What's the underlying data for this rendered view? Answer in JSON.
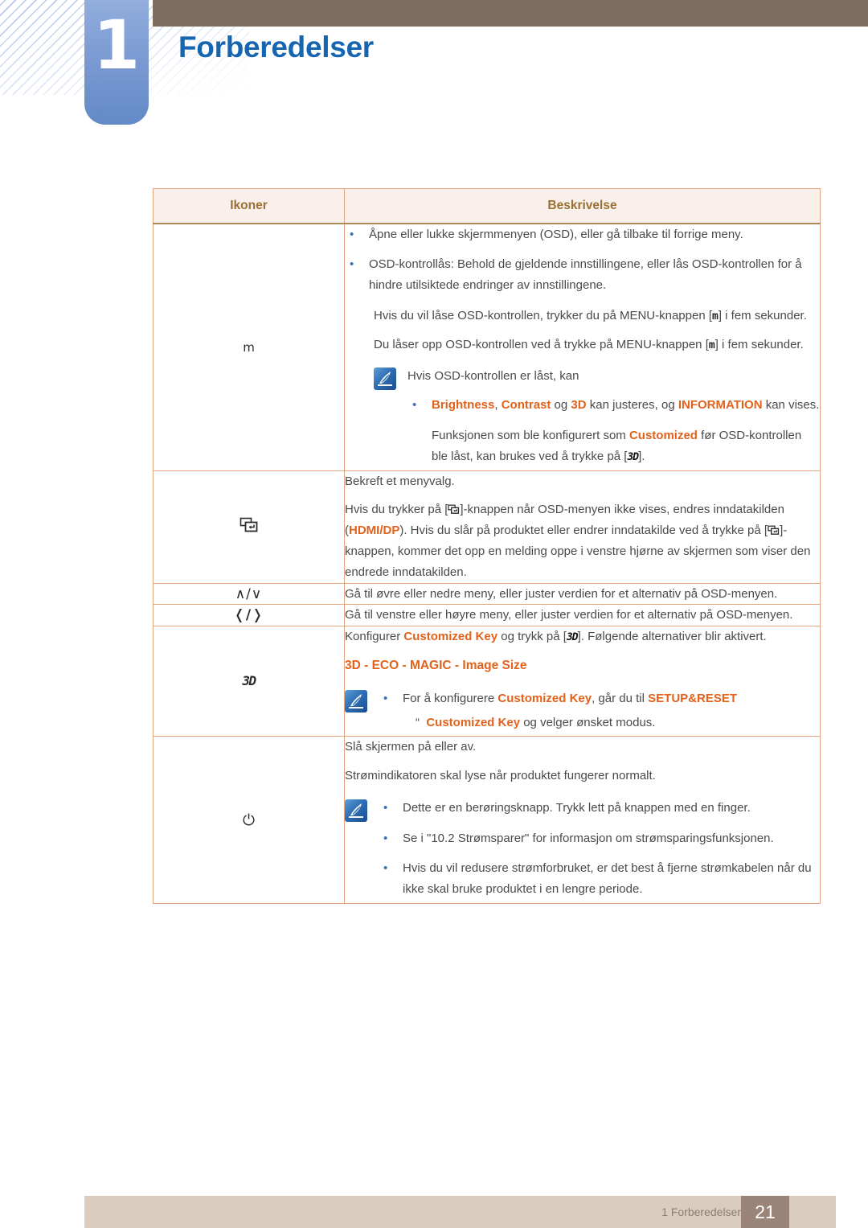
{
  "header": {
    "chapter_number": "1",
    "chapter_title": "Forberedelser"
  },
  "table": {
    "columns": [
      "Ikoner",
      "Beskrivelse"
    ],
    "rows": [
      {
        "icon_name": "menu-icon",
        "icon_glyph": "m",
        "blocks": {
          "b1": "Åpne eller lukke skjermmenyen (OSD), eller gå tilbake til forrige meny.",
          "b2": "OSD-kontrollås: Behold de gjeldende innstillingene, eller lås OSD-kontrollen for å hindre utilsiktede endringer av innstillingene.",
          "b3_pre": "Hvis du vil låse OSD-kontrollen, trykker du på MENU-knappen [",
          "b3_key": "m",
          "b3_post": "] i fem sekunder.",
          "b4_pre": "Du låser opp OSD-kontrollen ved å trykke på MENU-knappen [",
          "b4_key": "m",
          "b4_post": "] i fem sekunder.",
          "note_lead": "Hvis OSD-kontrollen er låst, kan",
          "note_b1_a": "Brightness",
          "note_b1_b": ", ",
          "note_b1_c": "Contrast",
          "note_b1_d": " og ",
          "note_b1_e": "3D",
          "note_b1_f": "  kan justeres, og ",
          "note_b1_g": "INFORMATION",
          "note_b1_h": " kan vises.",
          "note_b2_a": "Funksjonen som ble konfigurert som ",
          "note_b2_b": "Customized",
          "note_b2_c": " før OSD-kontrollen ble låst, kan brukes ved å trykke på [",
          "note_b2_key": "3D",
          "note_b2_d": "]."
        }
      },
      {
        "icon_name": "source-enter-icon",
        "icon_glyph": "",
        "blocks": {
          "p1": "Bekreft et menyvalg.",
          "p2_a": "Hvis du trykker på [",
          "p2_b": "]-knappen når OSD-menyen ikke vises, endres inndatakilden (",
          "p2_hdmi": "HDMI",
          "p2_slash": "/",
          "p2_dp": "DP",
          "p2_c": "). Hvis du slår på produktet eller endrer inndatakilde ved å trykke på [",
          "p2_d": "]-knappen, kommer det opp en melding oppe i venstre hjørne av skjermen som viser den endrede inndatakilden."
        }
      },
      {
        "icon_name": "up-down-icon",
        "icon_glyph": "∧/∨",
        "blocks": {
          "p1": "Gå til øvre eller nedre meny, eller juster verdien for et alternativ på OSD-menyen."
        }
      },
      {
        "icon_name": "left-right-icon",
        "icon_glyph": "❬/❭",
        "blocks": {
          "p1": "Gå til venstre eller høyre meny, eller juster verdien for et alternativ på OSD-menyen."
        }
      },
      {
        "icon_name": "3d-icon",
        "icon_glyph": "3D",
        "blocks": {
          "p1_a": "Konfigurer ",
          "p1_b": "Customized Key",
          "p1_c": " og trykk på [",
          "p1_key": "3D",
          "p1_d": "]. Følgende alternativer blir aktivert.",
          "p2": "3D - ECO - MAGIC - Image Size",
          "note_b1_a": "For å konfigurere ",
          "note_b1_b": "Customized Key",
          "note_b1_c": ", går du til ",
          "note_b1_d": "SETUP&RESET",
          "note_b2_quote": "“",
          "note_b2_a": "Customized Key",
          "note_b2_b": " og velger ønsket modus."
        }
      },
      {
        "icon_name": "power-icon",
        "icon_glyph": "⏻",
        "blocks": {
          "p1": "Slå skjermen på eller av.",
          "p2": "Strømindikatoren skal lyse når produktet fungerer normalt.",
          "note_b1": "Dette er en berøringsknapp. Trykk lett på knappen med en finger.",
          "note_b2": "Se i \"10.2 Strømsparer\" for informasjon om strømsparingsfunksjonen.",
          "note_b3": "Hvis du vil redusere strømforbruket, er det best å fjerne strømkabelen når du ikke skal bruke produktet i en lengre periode."
        }
      }
    ]
  },
  "footer": {
    "text": "1 Forberedelser",
    "page": "21"
  },
  "colors": {
    "accent_orange": "#e2621b",
    "title_blue": "#1565b0",
    "tab_blue": "#7c9bd3",
    "header_brown": "#7d6e60",
    "table_border": "#e3a681",
    "table_head_bg": "#f9efeb",
    "table_head_text": "#9a7133",
    "footer_bg": "#dacdbe",
    "footer_page_bg": "#9a8377"
  }
}
